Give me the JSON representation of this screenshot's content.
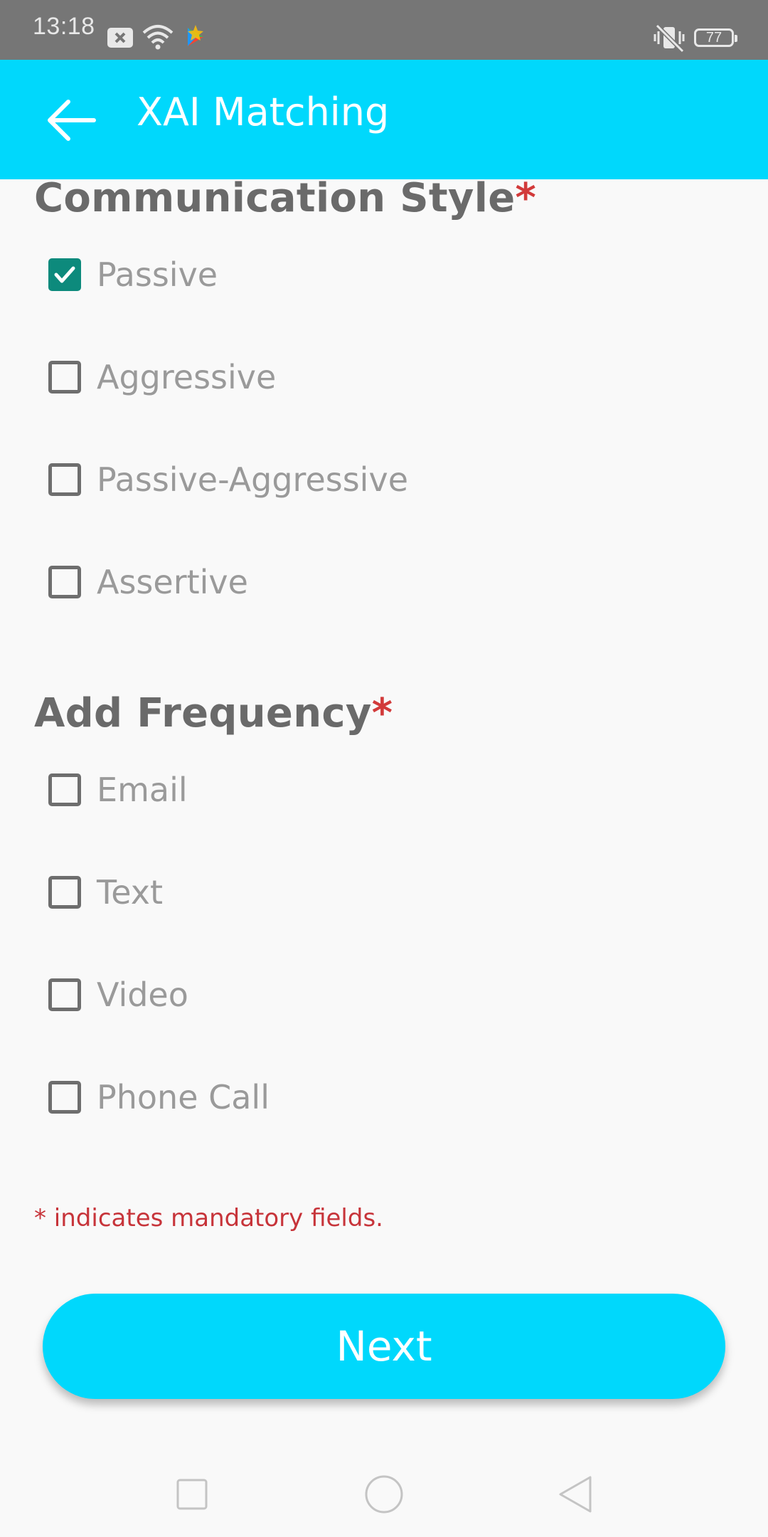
{
  "status_bar": {
    "time": "13:18",
    "battery": "77",
    "icons": [
      "notification-x-icon",
      "wifi-icon",
      "app-notification-icon",
      "vibrate-icon",
      "battery-icon"
    ]
  },
  "app_bar": {
    "title": "XAI Matching",
    "back_icon": "arrow-left-icon"
  },
  "sections": [
    {
      "title": "Communication Style",
      "required_mark": "*",
      "options": [
        {
          "label": "Passive",
          "checked": true
        },
        {
          "label": "Aggressive",
          "checked": false
        },
        {
          "label": "Passive-Aggressive",
          "checked": false
        },
        {
          "label": "Assertive",
          "checked": false
        }
      ]
    },
    {
      "title": "Add Frequency",
      "required_mark": "*",
      "options": [
        {
          "label": "Email",
          "checked": false
        },
        {
          "label": "Text",
          "checked": false
        },
        {
          "label": "Video",
          "checked": false
        },
        {
          "label": "Phone Call",
          "checked": false
        }
      ]
    }
  ],
  "mandatory_note": "* indicates mandatory fields.",
  "next_button": "Next",
  "colors": {
    "primary": "#00d8fc",
    "checkbox_checked": "#0d8a7c",
    "required": "#d23a3a"
  },
  "nav_bar": {
    "icons": [
      "recent-apps-icon",
      "home-icon",
      "back-icon"
    ]
  }
}
